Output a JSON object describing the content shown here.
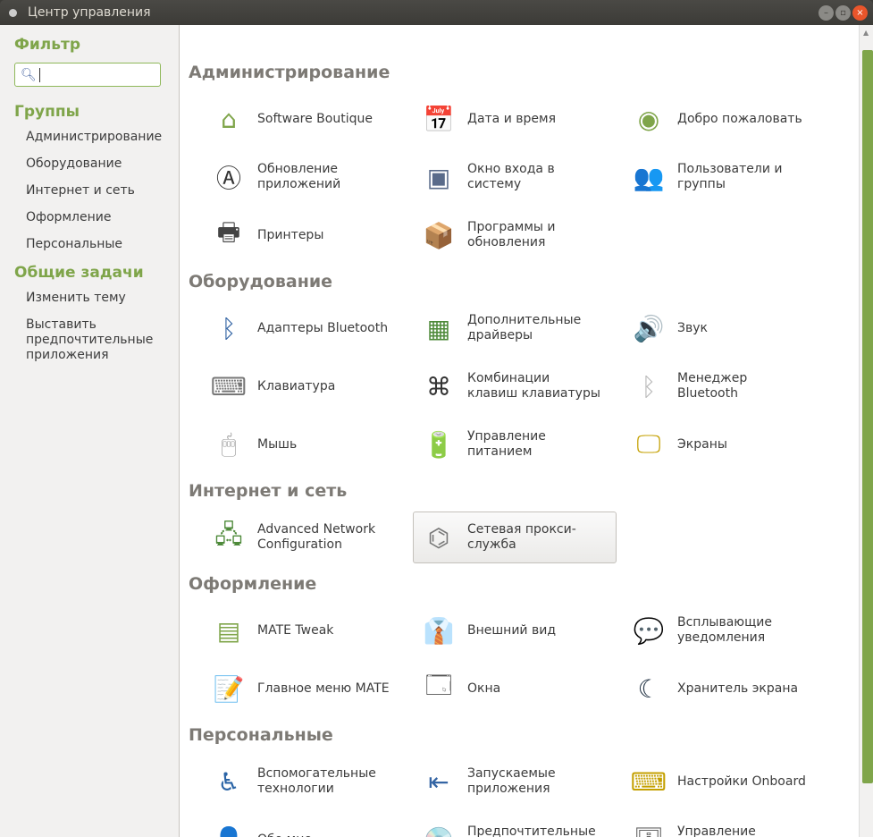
{
  "window": {
    "title": "Центр управления"
  },
  "sidebar": {
    "filter_heading": "Фильтр",
    "search": {
      "value": "",
      "placeholder": ""
    },
    "groups_heading": "Группы",
    "groups": [
      "Администрирование",
      "Оборудование",
      "Интернет и сеть",
      "Оформление",
      "Персональные"
    ],
    "tasks_heading": "Общие задачи",
    "tasks": [
      "Изменить тему",
      "Выставить предпочтительные приложения"
    ]
  },
  "sections": [
    {
      "title": "Администрирование",
      "items": [
        {
          "label": "Software Boutique",
          "icon": "hanger-icon"
        },
        {
          "label": "Дата и время",
          "icon": "calendar-clock-icon"
        },
        {
          "label": "Добро пожаловать",
          "icon": "ubuntu-mate-icon"
        },
        {
          "label": "Обновление приложений",
          "icon": "software-update-icon"
        },
        {
          "label": "Окно входа в систему",
          "icon": "login-window-icon"
        },
        {
          "label": "Пользователи и группы",
          "icon": "users-icon"
        },
        {
          "label": "Принтеры",
          "icon": "printer-icon"
        },
        {
          "label": "Программы и обновления",
          "icon": "software-sources-icon"
        }
      ]
    },
    {
      "title": "Оборудование",
      "items": [
        {
          "label": "Адаптеры Bluetooth",
          "icon": "bluetooth-adapter-icon"
        },
        {
          "label": "Дополнительные драйверы",
          "icon": "driver-board-icon"
        },
        {
          "label": "Звук",
          "icon": "sound-icon"
        },
        {
          "label": "Клавиатура",
          "icon": "keyboard-icon"
        },
        {
          "label": "Комбинации клавиш клавиатуры",
          "icon": "shortcuts-icon"
        },
        {
          "label": "Менеджер Bluetooth",
          "icon": "bluetooth-icon"
        },
        {
          "label": "Мышь",
          "icon": "mouse-icon"
        },
        {
          "label": "Управление питанием",
          "icon": "power-icon"
        },
        {
          "label": "Экраны",
          "icon": "display-icon"
        }
      ]
    },
    {
      "title": "Интернет и сеть",
      "items": [
        {
          "label": "Advanced Network Configuration",
          "icon": "network-icon"
        },
        {
          "label": "Сетевая прокси-служба",
          "icon": "proxy-icon"
        }
      ]
    },
    {
      "title": "Оформление",
      "items": [
        {
          "label": "MATE Tweak",
          "icon": "mate-tweak-icon"
        },
        {
          "label": "Внешний вид",
          "icon": "appearance-icon"
        },
        {
          "label": "Всплывающие уведомления",
          "icon": "notification-icon"
        },
        {
          "label": "Главное меню MATE",
          "icon": "menu-editor-icon"
        },
        {
          "label": "Окна",
          "icon": "windows-icon"
        },
        {
          "label": "Хранитель экрана",
          "icon": "screensaver-icon"
        }
      ]
    },
    {
      "title": "Персональные",
      "items": [
        {
          "label": "Вспомогательные технологии",
          "icon": "accessibility-icon"
        },
        {
          "label": "Запускаемые приложения",
          "icon": "startup-apps-icon"
        },
        {
          "label": "Настройки Onboard",
          "icon": "onboard-icon"
        },
        {
          "label": "Обо мне",
          "icon": "about-me-icon"
        },
        {
          "label": "Предпочтительные приложения",
          "icon": "preferred-apps-icon"
        },
        {
          "label": "Управление файлами",
          "icon": "file-management-icon"
        }
      ]
    }
  ]
}
